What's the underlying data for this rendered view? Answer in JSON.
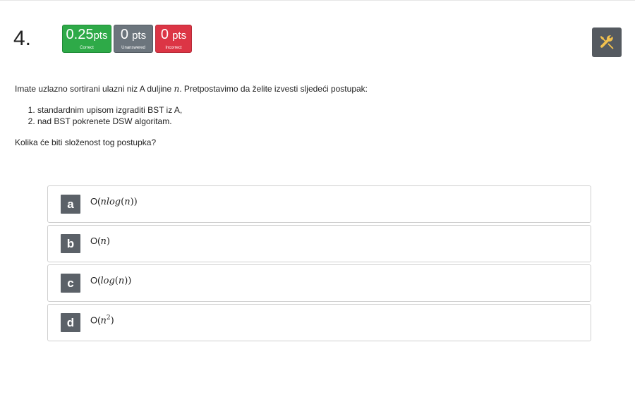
{
  "question": {
    "number": "4.",
    "badges": {
      "correct": {
        "value": "0.25",
        "unit": "pts",
        "label": "Correct"
      },
      "unanswered": {
        "value": "0",
        "unit": "pts",
        "label": "Unanswered"
      },
      "incorrect": {
        "value": "0",
        "unit": "pts",
        "label": "Incorrect"
      }
    },
    "tools_icon": "tools-icon",
    "intro_before": "Imate uzlazno sortirani ulazni niz A duljine ",
    "intro_var": "n",
    "intro_after": ". Pretpostavimo da želite izvesti sljedeći postupak:",
    "steps": [
      "standardnim upisom izgraditi BST iz A,",
      "nad BST pokrenete DSW algoritam."
    ],
    "prompt": "Kolika će biti složenost tog postupka?"
  },
  "answers": [
    {
      "letter": "a",
      "prefix": "O(",
      "expr": "nlog",
      "open": "(",
      "var": "n",
      "close": "))"
    },
    {
      "letter": "b",
      "prefix": "O(",
      "expr": "n",
      "close": ")"
    },
    {
      "letter": "c",
      "prefix": "O(",
      "expr": "log",
      "open": "(",
      "var": "n",
      "close": "))"
    },
    {
      "letter": "d",
      "prefix": "O(",
      "expr": "n",
      "sup": "2",
      "close": ")"
    }
  ],
  "colors": {
    "correct": "#2eaa48",
    "unanswered": "#6c757d",
    "incorrect": "#dc3545",
    "tools_bg": "#555a60",
    "tools_icon": "#f2c14e",
    "letter_bg": "#5b6168"
  }
}
